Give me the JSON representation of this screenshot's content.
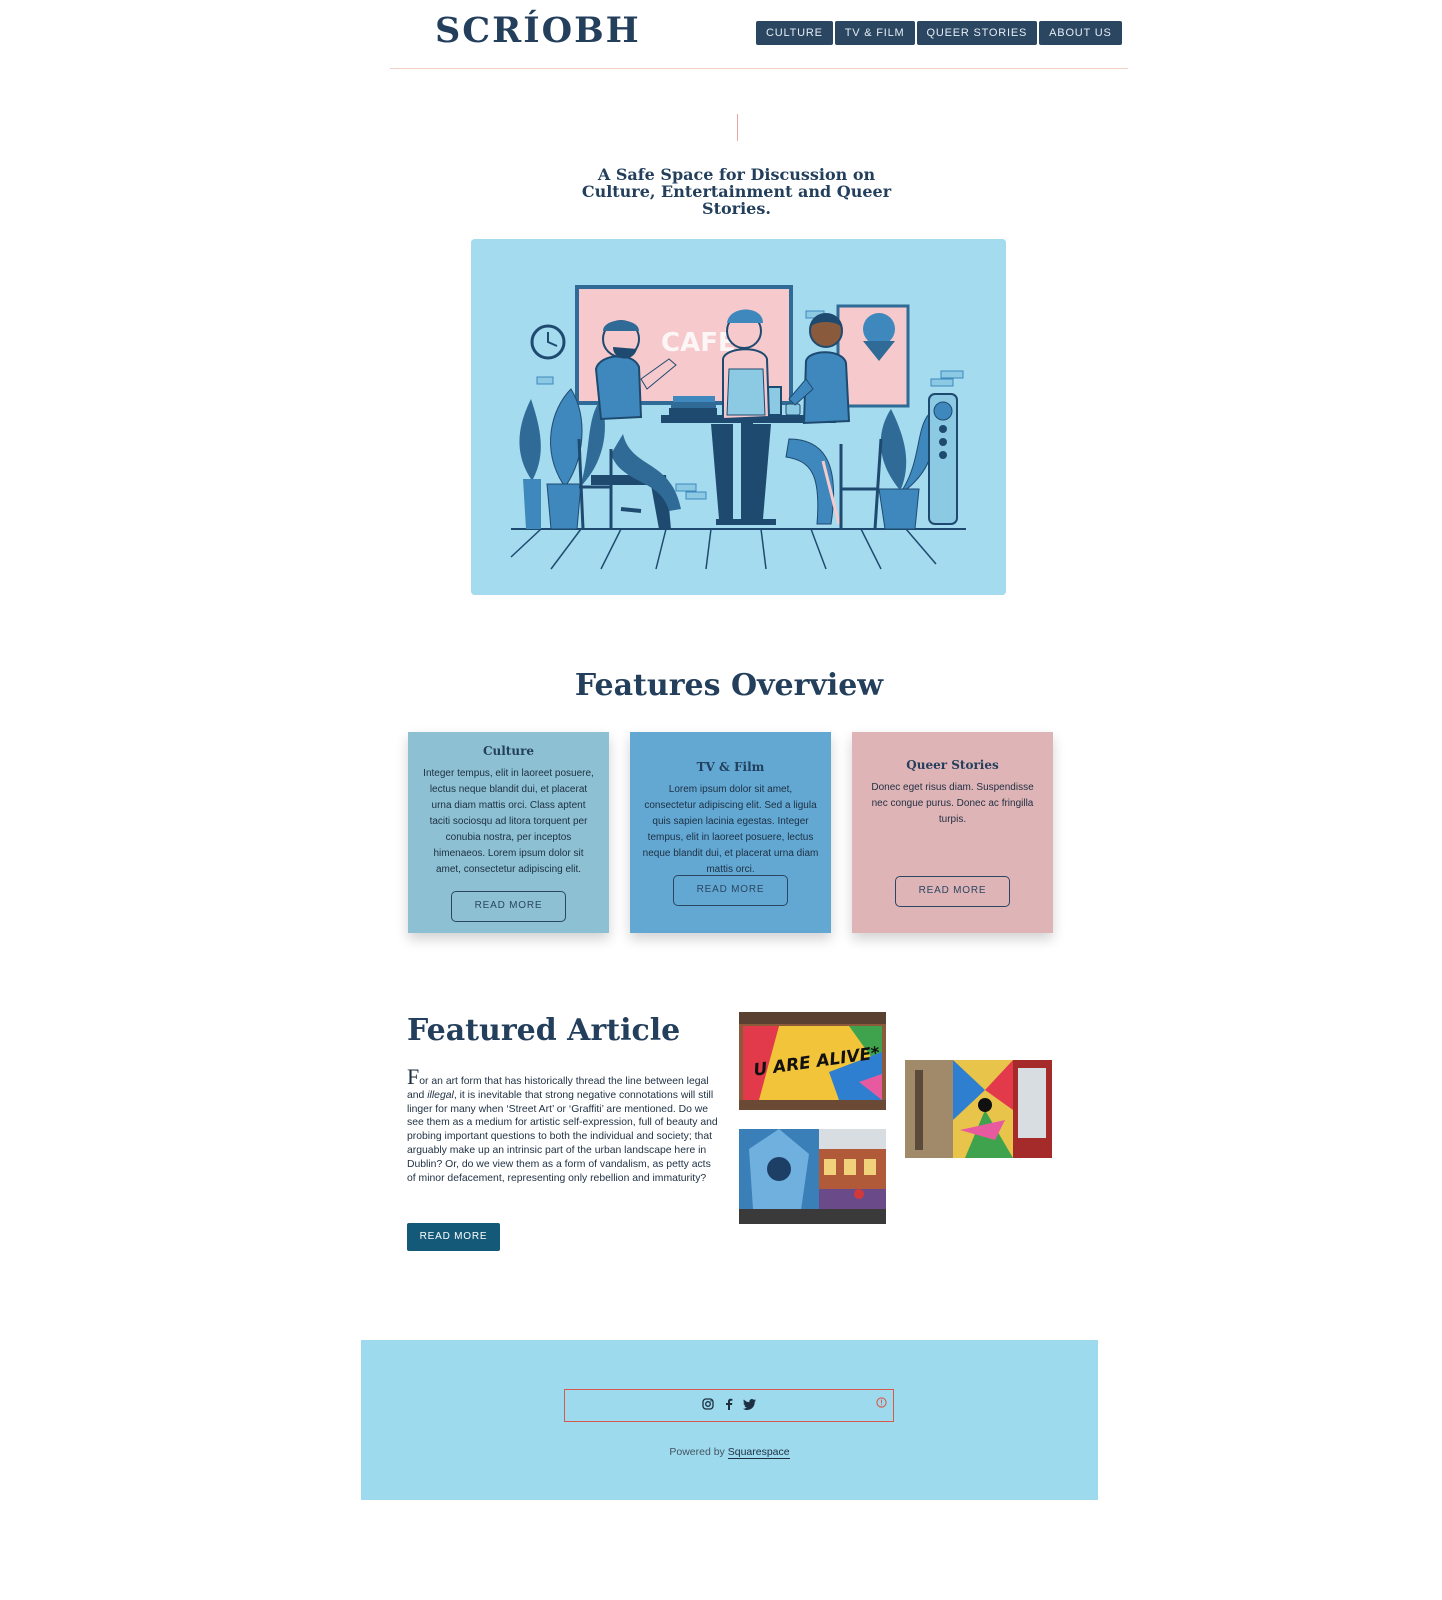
{
  "header": {
    "logo": "SCRÍOBH",
    "nav": [
      "CULTURE",
      "TV & FILM",
      "QUEER STORIES",
      "ABOUT US"
    ]
  },
  "hero": {
    "tagline": "A Safe Space for Discussion on Culture, Entertainment and Queer Stories.",
    "sign_text": "CAFÉ",
    "colors": {
      "background": "#a4dbee",
      "pink": "#f6c9cc",
      "navy": "#1f4a70",
      "blue": "#3e88bd"
    }
  },
  "features": {
    "title": "Features Overview",
    "cards": [
      {
        "title": "Culture",
        "text": "Integer tempus, elit in laoreet posuere, lectus neque blandit dui, et placerat urna diam mattis orci. Class aptent taciti sociosqu ad litora torquent per conubia nostra, per inceptos himenaeos. Lorem ipsum dolor sit amet, consectetur adipiscing elit.",
        "button": "READ MORE",
        "color": "#8cc0d2"
      },
      {
        "title": "TV & Film",
        "text": "Lorem ipsum dolor sit amet, consectetur adipiscing elit. Sed a ligula quis sapien lacinia egestas. Integer tempus, elit in laoreet posuere, lectus neque blandit dui, et placerat urna diam mattis orci.",
        "button": "READ MORE",
        "color": "#62a8d3"
      },
      {
        "title": "Queer Stories",
        "text": "Donec eget risus diam. Suspendisse nec congue purus. Donec ac fringilla turpis.",
        "button": "READ MORE",
        "color": "#dfb4b7"
      }
    ]
  },
  "featured_article": {
    "title": "Featured Article",
    "dropcap": "F",
    "body_start": "or an art form that has historically thread the line between legal and ",
    "body_em": "illegal",
    "body_end": ", it is inevitable that strong negative connotations will still linger for many when ‘Street Art’ or ‘Graffiti’ are mentioned. Do we see them as a medium for artistic self-expression, full of beauty and probing important questions to both the individual and society; that arguably make up an intrinsic part of the urban landscape here in Dublin? Or, do we view them as a form of vandalism, as petty acts of minor defacement, representing only rebellion and immaturity?",
    "button": "READ MORE",
    "mural_text": "U ARE ALIVE*"
  },
  "footer": {
    "social_icons": [
      "instagram-icon",
      "facebook-icon",
      "twitter-icon"
    ],
    "powered_by": "Powered by",
    "powered_link": "Squarespace"
  }
}
